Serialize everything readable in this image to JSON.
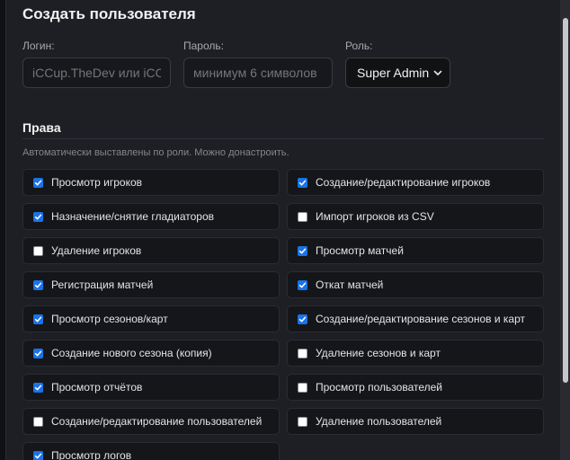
{
  "modal": {
    "title": "Создать пользователя",
    "login": {
      "label": "Логин:",
      "value": "",
      "placeholder": "iCCup.TheDev или iCCu"
    },
    "password": {
      "label": "Пароль:",
      "value": "",
      "placeholder": "минимум 6 символов"
    },
    "role": {
      "label": "Роль:",
      "selected": "Super Admin"
    },
    "rights": {
      "title": "Права",
      "hint": "Автоматически выставлены по роли. Можно донастроить.",
      "items": [
        {
          "label": "Просмотр игроков",
          "checked": true
        },
        {
          "label": "Создание/редактирование игроков",
          "checked": true
        },
        {
          "label": "Назначение/снятие гладиаторов",
          "checked": true
        },
        {
          "label": "Импорт игроков из CSV",
          "checked": false
        },
        {
          "label": "Удаление игроков",
          "checked": false
        },
        {
          "label": "Просмотр матчей",
          "checked": true
        },
        {
          "label": "Регистрация матчей",
          "checked": true
        },
        {
          "label": "Откат матчей",
          "checked": true
        },
        {
          "label": "Просмотр сезонов/карт",
          "checked": true
        },
        {
          "label": "Создание/редактирование сезонов и карт",
          "checked": true
        },
        {
          "label": "Создание нового сезона (копия)",
          "checked": true
        },
        {
          "label": "Удаление сезонов и карт",
          "checked": false
        },
        {
          "label": "Просмотр отчётов",
          "checked": true
        },
        {
          "label": "Просмотр пользователей",
          "checked": false
        },
        {
          "label": "Создание/редактирование пользователей",
          "checked": false
        },
        {
          "label": "Удаление пользователей",
          "checked": false
        },
        {
          "label": "Просмотр логов",
          "checked": true
        }
      ]
    }
  },
  "colors": {
    "accent": "#1a73e8",
    "background": "#1e1f24",
    "card": "#15161a"
  }
}
